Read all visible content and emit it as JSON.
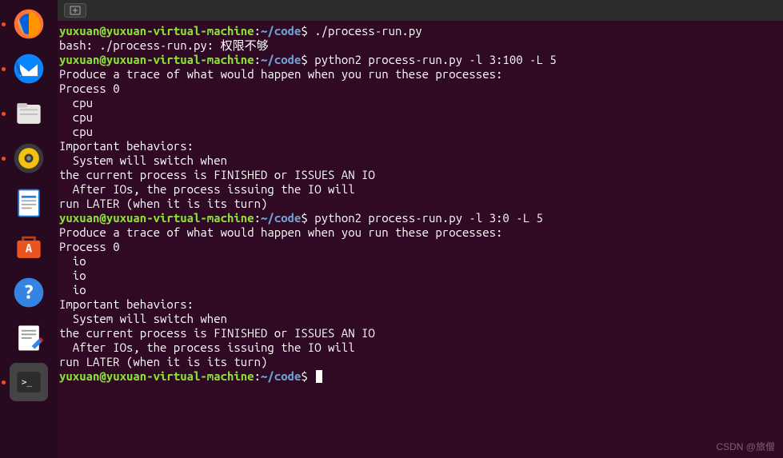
{
  "dock": {
    "items": [
      {
        "name": "firefox-icon"
      },
      {
        "name": "thunderbird-icon"
      },
      {
        "name": "files-icon"
      },
      {
        "name": "rhythmbox-icon"
      },
      {
        "name": "libreoffice-writer-icon"
      },
      {
        "name": "ubuntu-software-icon"
      },
      {
        "name": "help-icon"
      },
      {
        "name": "text-editor-icon"
      },
      {
        "name": "terminal-icon"
      }
    ]
  },
  "tabbar": {
    "add_label": "+"
  },
  "prompt": {
    "user_host": "yuxuan@yuxuan-virtual-machine",
    "colon": ":",
    "path": "~/code",
    "dollar": "$"
  },
  "terminal": {
    "lines": [
      {
        "type": "prompt",
        "cmd": " ./process-run.py"
      },
      {
        "type": "out",
        "text": "bash: ./process-run.py: 权限不够"
      },
      {
        "type": "prompt",
        "cmd": " python2 process-run.py -l 3:100 -L 5"
      },
      {
        "type": "out",
        "text": "Produce a trace of what would happen when you run these processes:"
      },
      {
        "type": "out",
        "text": "Process 0"
      },
      {
        "type": "out",
        "text": "  cpu"
      },
      {
        "type": "out",
        "text": "  cpu"
      },
      {
        "type": "out",
        "text": "  cpu"
      },
      {
        "type": "out",
        "text": ""
      },
      {
        "type": "out",
        "text": "Important behaviors:"
      },
      {
        "type": "out",
        "text": "  System will switch when"
      },
      {
        "type": "out",
        "text": "the current process is FINISHED or ISSUES AN IO"
      },
      {
        "type": "out",
        "text": "  After IOs, the process issuing the IO will"
      },
      {
        "type": "out",
        "text": "run LATER (when it is its turn)"
      },
      {
        "type": "out",
        "text": ""
      },
      {
        "type": "prompt",
        "cmd": " python2 process-run.py -l 3:0 -L 5"
      },
      {
        "type": "out",
        "text": "Produce a trace of what would happen when you run these processes:"
      },
      {
        "type": "out",
        "text": "Process 0"
      },
      {
        "type": "out",
        "text": "  io"
      },
      {
        "type": "out",
        "text": "  io"
      },
      {
        "type": "out",
        "text": "  io"
      },
      {
        "type": "out",
        "text": ""
      },
      {
        "type": "out",
        "text": "Important behaviors:"
      },
      {
        "type": "out",
        "text": "  System will switch when"
      },
      {
        "type": "out",
        "text": "the current process is FINISHED or ISSUES AN IO"
      },
      {
        "type": "out",
        "text": "  After IOs, the process issuing the IO will"
      },
      {
        "type": "out",
        "text": "run LATER (when it is its turn)"
      },
      {
        "type": "out",
        "text": ""
      },
      {
        "type": "prompt",
        "cmd": " ",
        "cursor": true
      }
    ]
  },
  "watermark": "CSDN @旅僧"
}
